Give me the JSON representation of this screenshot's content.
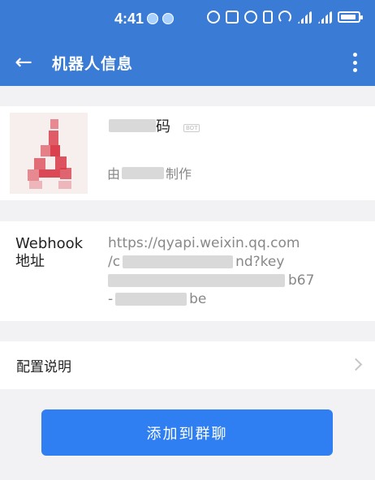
{
  "status_bar": {
    "time": "4:41",
    "icons": [
      "chat-notification-icon",
      "download-notification-icon",
      "eye-icon",
      "nfc-icon",
      "alarm-icon",
      "vibrate-icon",
      "wifi-icon",
      "signal-4g-icon",
      "signal-4g-icon",
      "battery-charging-icon"
    ],
    "signal_labels": [
      "4G",
      "4G"
    ]
  },
  "app_bar": {
    "title": "机器人信息",
    "back_icon": "arrow-left-icon",
    "more_icon": "more-vertical-icon"
  },
  "bot": {
    "name_visible": "码",
    "tag": "BOT",
    "creator_prefix": "由",
    "creator_suffix": "制作"
  },
  "webhook": {
    "label": "Webhook 地址",
    "line1": "https://qyapi.weixin.qq.com",
    "line2_prefix": "/c",
    "line2_suffix": "nd?key",
    "line3_suffix": "b67",
    "line4_prefix": "-",
    "line4_suffix": "be"
  },
  "config": {
    "label": "配置说明",
    "chevron_icon": "chevron-right-icon"
  },
  "actions": {
    "add_to_group": "添加到群聊"
  },
  "colors": {
    "app_bar": "#3a7bd5",
    "primary_button": "#2f7ff2",
    "background": "#f2f2f4"
  }
}
